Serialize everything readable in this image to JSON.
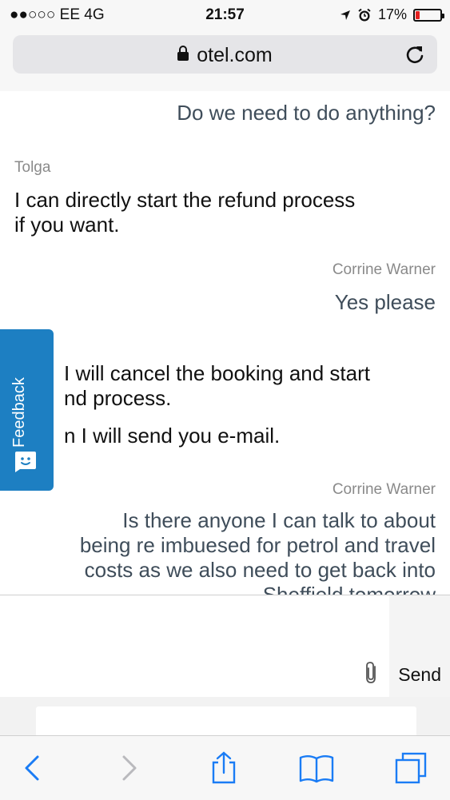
{
  "status_bar": {
    "carrier": "●●○○○ EE   4G",
    "time": "21:57",
    "battery": "17%",
    "battery_level": 0.17
  },
  "browser": {
    "url": "otel.com"
  },
  "chat": {
    "messages": [
      {
        "sender": "",
        "text": "Do we need to do anything?"
      },
      {
        "sender": "Tolga",
        "lines": [
          "I can directly start the refund process",
          "if you want."
        ]
      },
      {
        "sender": "Corrine Warner",
        "text": "Yes please"
      },
      {
        "sender": "",
        "lines": [
          "I will cancel the booking and start",
          "nd process.",
          "n I will send you e-mail."
        ]
      },
      {
        "sender": "Corrine Warner",
        "lines": [
          "Is there anyone I can talk to about",
          "being re imbuesed for petrol and travel",
          "costs as we also need to get back into",
          "Sheffield tomorrow"
        ]
      }
    ]
  },
  "feedback": {
    "label": "Feedback"
  },
  "composer": {
    "placeholder": "",
    "send_label": "Send"
  },
  "colors": {
    "feedback_tab": "#1d7fc2",
    "agent_text": "#3f4d5a",
    "ios_blue": "#1a7cf5",
    "battery_low": "#e3201f"
  },
  "toolbar": {
    "icons": [
      "back-icon",
      "forward-icon",
      "share-icon",
      "bookmarks-icon",
      "tabs-icon"
    ]
  }
}
